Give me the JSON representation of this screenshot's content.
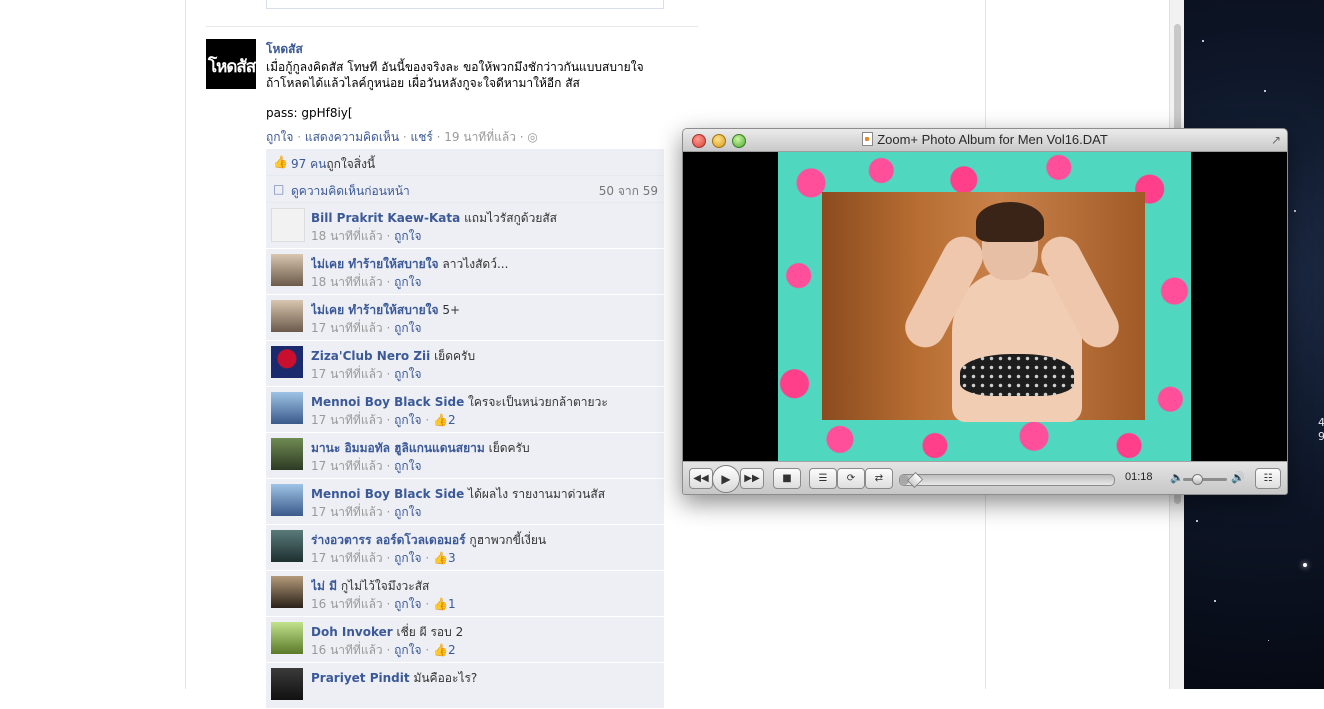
{
  "post": {
    "avatar_text": "โหดสัส",
    "author": "โหดสัส",
    "text_line1": "เมื่อกู้กูลงคิดสัส โทษที อันนี้ของจริงละ ขอให้พวกมึงชักว่าวกันแบบสบายใจ",
    "text_line2": "ถ้าโหลดได้แล้วไลค์กูหน่อย เผื่อวันหลังกูจะใจดีหามาให้อีก สัส",
    "pass": "pass: gpHf8iy[",
    "actions": {
      "like": "ถูกใจ",
      "comment": "แสดงความคิดเห็น",
      "share": "แชร์",
      "time": "19 นาทีที่แล้ว",
      "sep": " · "
    }
  },
  "ufi": {
    "likes_count": "97 คน",
    "likes_suffix": "ถูกใจสิ่งนี้",
    "view_prev": "ดูความคิดเห็นก่อนหน้า",
    "count_text": "50 จาก 59"
  },
  "comments": [
    {
      "name": "Bill Prakrit Kaew-Kata",
      "text": "แถมไวรัสกูด้วยสัส",
      "time": "18 นาทีที่แล้ว",
      "like": "ถูกใจ",
      "likes": ""
    },
    {
      "name": "ไม่เคย ทำร้ายให้สบายใจ",
      "text": "ลาวไงสัดว์...",
      "time": "18 นาทีที่แล้ว",
      "like": "ถูกใจ",
      "likes": ""
    },
    {
      "name": "ไม่เคย ทำร้ายให้สบายใจ",
      "text": "5+",
      "time": "17 นาทีที่แล้ว",
      "like": "ถูกใจ",
      "likes": ""
    },
    {
      "name": "Ziza'Club Nero Zii",
      "text": "เย็ดครับ",
      "time": "17 นาทีที่แล้ว",
      "like": "ถูกใจ",
      "likes": ""
    },
    {
      "name": "Mennoi Boy Black Side",
      "text": "ใครจะเป็นหน่วยกล้าตายวะ",
      "time": "17 นาทีที่แล้ว",
      "like": "ถูกใจ",
      "likes": "2"
    },
    {
      "name": "มานะ อิมมอทัล ฮูลิแกนแดนสยาม",
      "text": "เย็ดครับ",
      "time": "17 นาทีที่แล้ว",
      "like": "ถูกใจ",
      "likes": ""
    },
    {
      "name": "Mennoi Boy Black Side",
      "text": "ได้ผลไง รายงานมาด่วนสัส",
      "time": "17 นาทีที่แล้ว",
      "like": "ถูกใจ",
      "likes": ""
    },
    {
      "name": "ร่างอวตารร ลอร์ดโวลเดอมอร์",
      "text": "กูฮาพวกขี้เงี่ยน",
      "time": "17 นาทีที่แล้ว",
      "like": "ถูกใจ",
      "likes": "3"
    },
    {
      "name": "ไม่ มี",
      "text": "กูไม่ไว้ใจมึงวะสัส",
      "time": "16 นาทีที่แล้ว",
      "like": "ถูกใจ",
      "likes": "1"
    },
    {
      "name": "Doh Invoker",
      "text": "เชี่ย ผี รอบ 2",
      "time": "16 นาทีที่แล้ว",
      "like": "ถูกใจ",
      "likes": "2"
    },
    {
      "name": "Prariyet Pindit",
      "text": "มันคืออะไร?",
      "time": "",
      "like": "",
      "likes": ""
    }
  ],
  "player": {
    "title": "Zoom+ Photo Album for Men Vol16.DAT",
    "time": "01:18",
    "progress": 0.04,
    "volume": 0.3
  },
  "desktop": {
    "text1": "4",
    "text2": "9"
  },
  "colors": {
    "link": "#3b5998",
    "ufi_bg": "#edeff4"
  }
}
